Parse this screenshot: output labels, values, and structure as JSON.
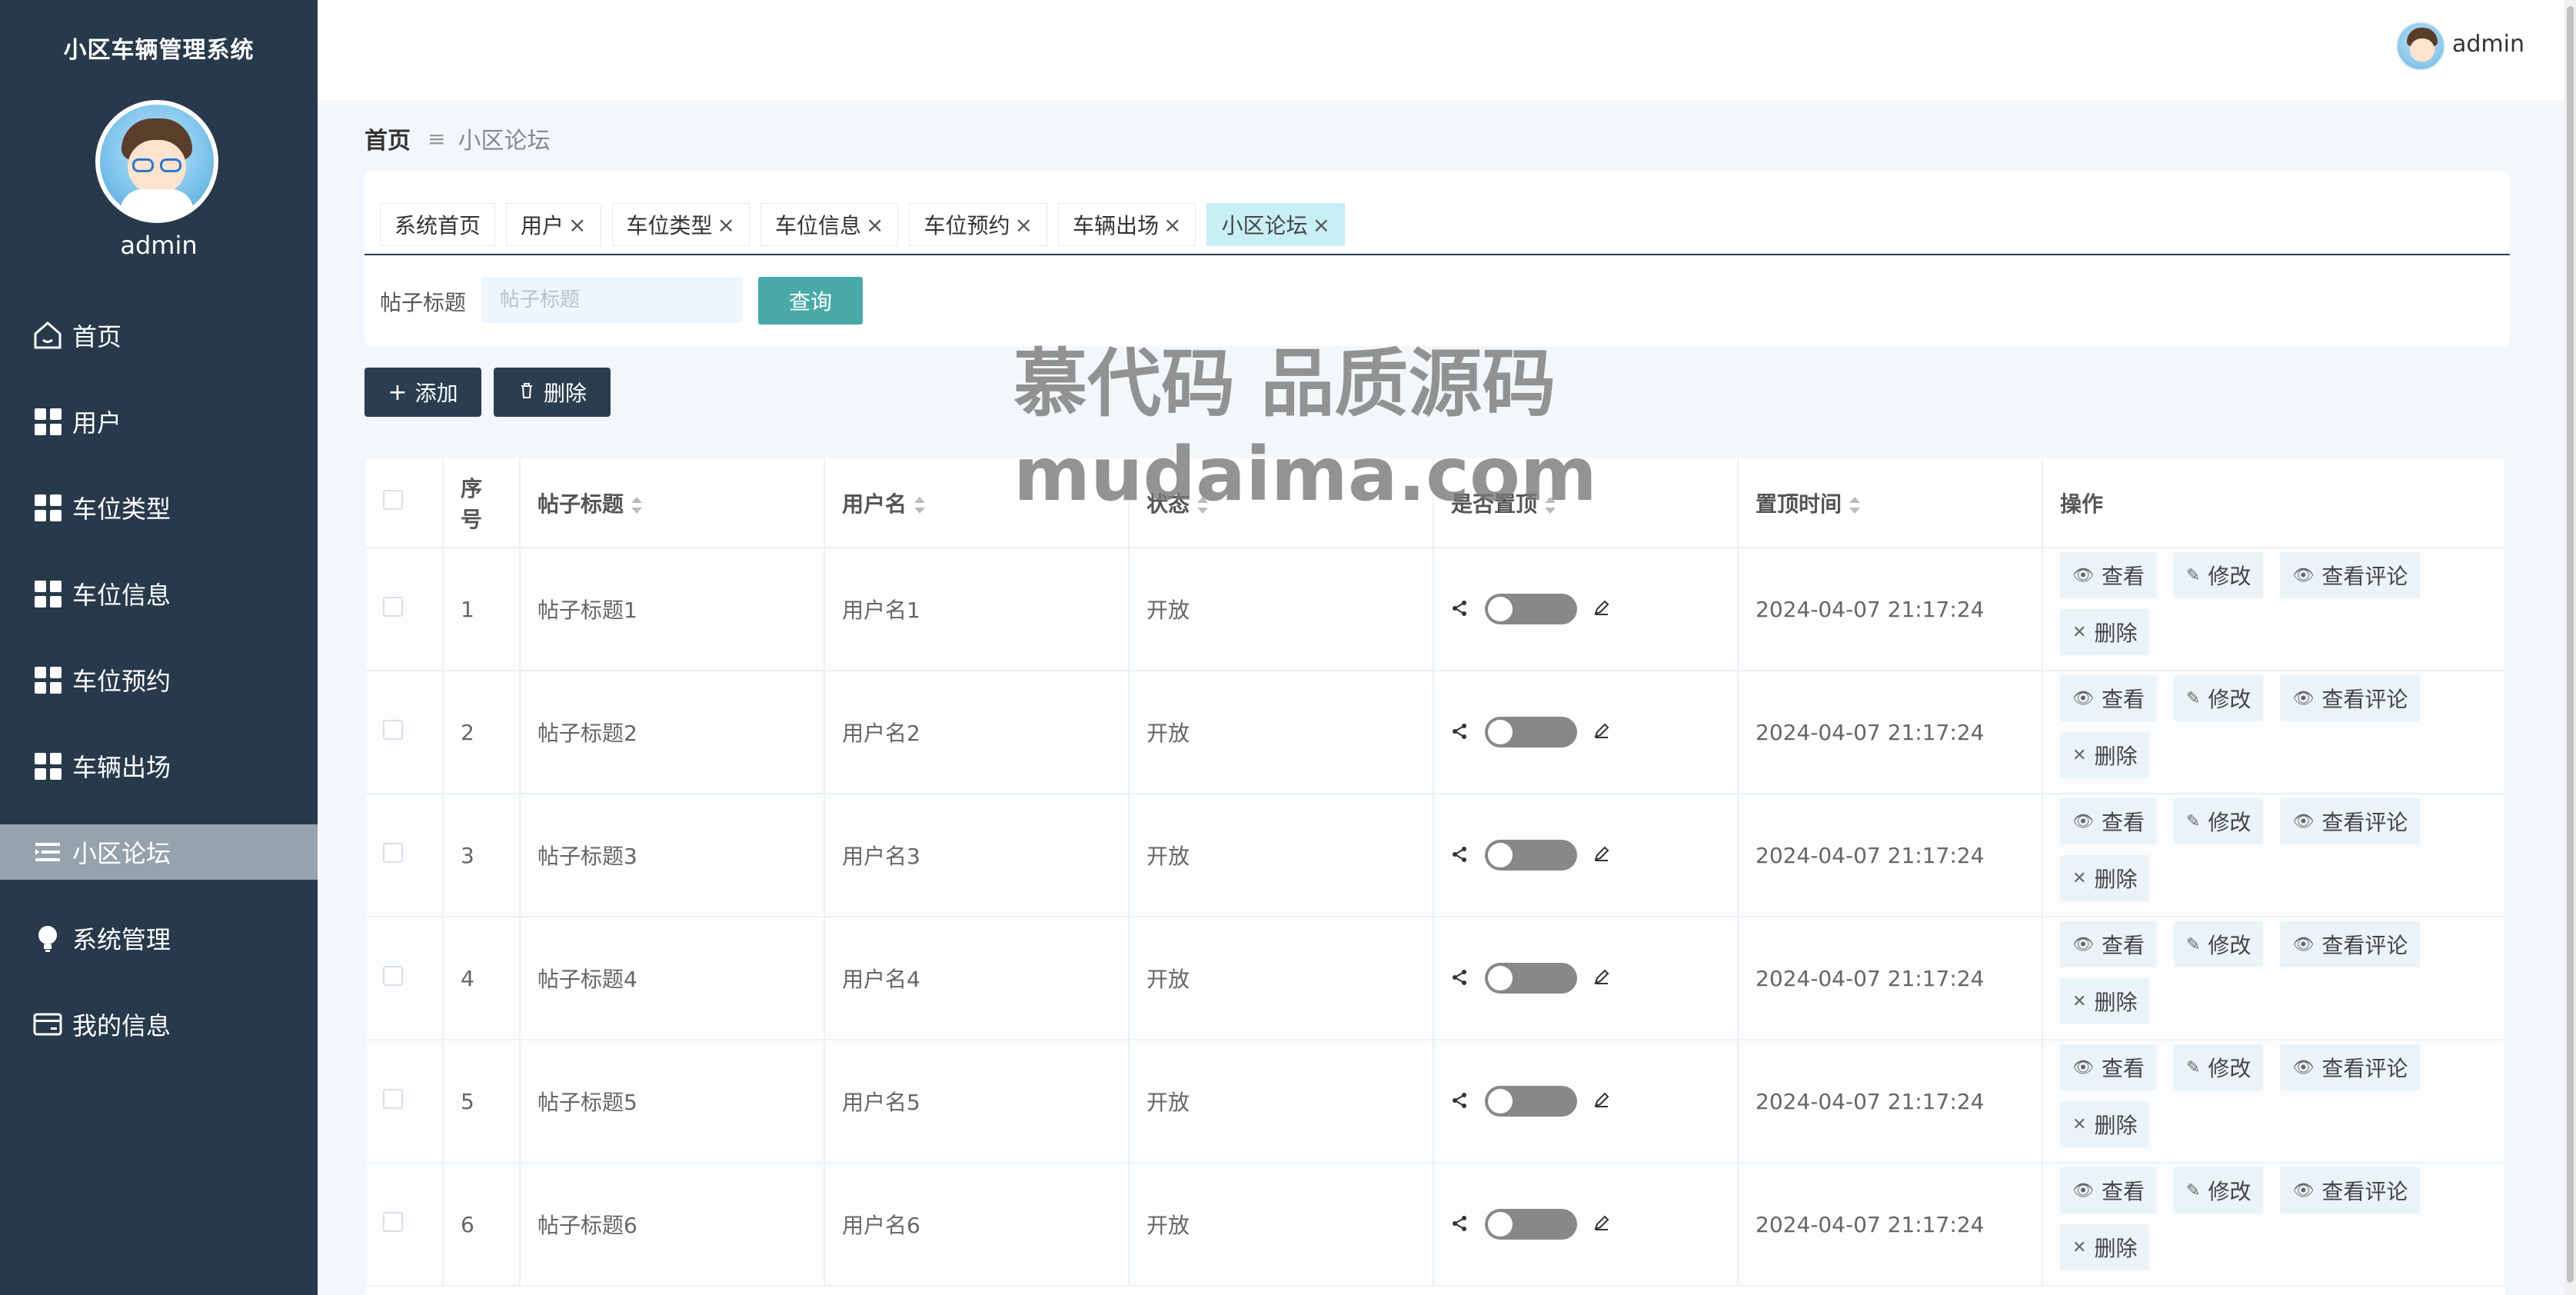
{
  "app": {
    "title": "小区车辆管理系统",
    "username": "admin"
  },
  "sidebar": {
    "items": [
      {
        "label": "首页",
        "icon": "home-icon"
      },
      {
        "label": "用户",
        "icon": "grid-icon"
      },
      {
        "label": "车位类型",
        "icon": "grid-icon"
      },
      {
        "label": "车位信息",
        "icon": "grid-icon"
      },
      {
        "label": "车位预约",
        "icon": "grid-icon"
      },
      {
        "label": "车辆出场",
        "icon": "grid-icon"
      },
      {
        "label": "小区论坛",
        "icon": "list-icon",
        "active": true
      },
      {
        "label": "系统管理",
        "icon": "bulb-icon"
      },
      {
        "label": "我的信息",
        "icon": "card-icon"
      }
    ]
  },
  "header": {
    "username": "admin"
  },
  "breadcrumb": {
    "home": "首页",
    "current": "小区论坛"
  },
  "tabs": [
    {
      "label": "系统首页",
      "closable": false
    },
    {
      "label": "用户",
      "closable": true
    },
    {
      "label": "车位类型",
      "closable": true
    },
    {
      "label": "车位信息",
      "closable": true
    },
    {
      "label": "车位预约",
      "closable": true
    },
    {
      "label": "车辆出场",
      "closable": true
    },
    {
      "label": "小区论坛",
      "closable": true,
      "active": true
    }
  ],
  "search": {
    "label": "帖子标题",
    "placeholder": "帖子标题",
    "value": "",
    "button": "查询"
  },
  "toolbar": {
    "add_label": "添加",
    "delete_label": "删除"
  },
  "watermark": {
    "line1": "慕代码 品质源码",
    "line2": "mudaima.com"
  },
  "table": {
    "columns": [
      "序号",
      "帖子标题",
      "用户名",
      "状态",
      "是否置顶",
      "置顶时间",
      "操作"
    ],
    "rows": [
      {
        "index": "1",
        "title": "帖子标题1",
        "user": "用户名1",
        "status": "开放",
        "time": "2024-04-07 21:17:24"
      },
      {
        "index": "2",
        "title": "帖子标题2",
        "user": "用户名2",
        "status": "开放",
        "time": "2024-04-07 21:17:24"
      },
      {
        "index": "3",
        "title": "帖子标题3",
        "user": "用户名3",
        "status": "开放",
        "time": "2024-04-07 21:17:24"
      },
      {
        "index": "4",
        "title": "帖子标题4",
        "user": "用户名4",
        "status": "开放",
        "time": "2024-04-07 21:17:24"
      },
      {
        "index": "5",
        "title": "帖子标题5",
        "user": "用户名5",
        "status": "开放",
        "time": "2024-04-07 21:17:24"
      },
      {
        "index": "6",
        "title": "帖子标题6",
        "user": "用户名6",
        "status": "开放",
        "time": "2024-04-07 21:17:24"
      }
    ],
    "row_actions": {
      "view": "查看",
      "edit": "修改",
      "comments": "查看评论",
      "delete": "删除"
    }
  },
  "colors": {
    "sidebar": "#27394b",
    "accent": "#4aaaaa",
    "active_nav": "#96a3ad",
    "active_tab": "#c8eef6"
  }
}
